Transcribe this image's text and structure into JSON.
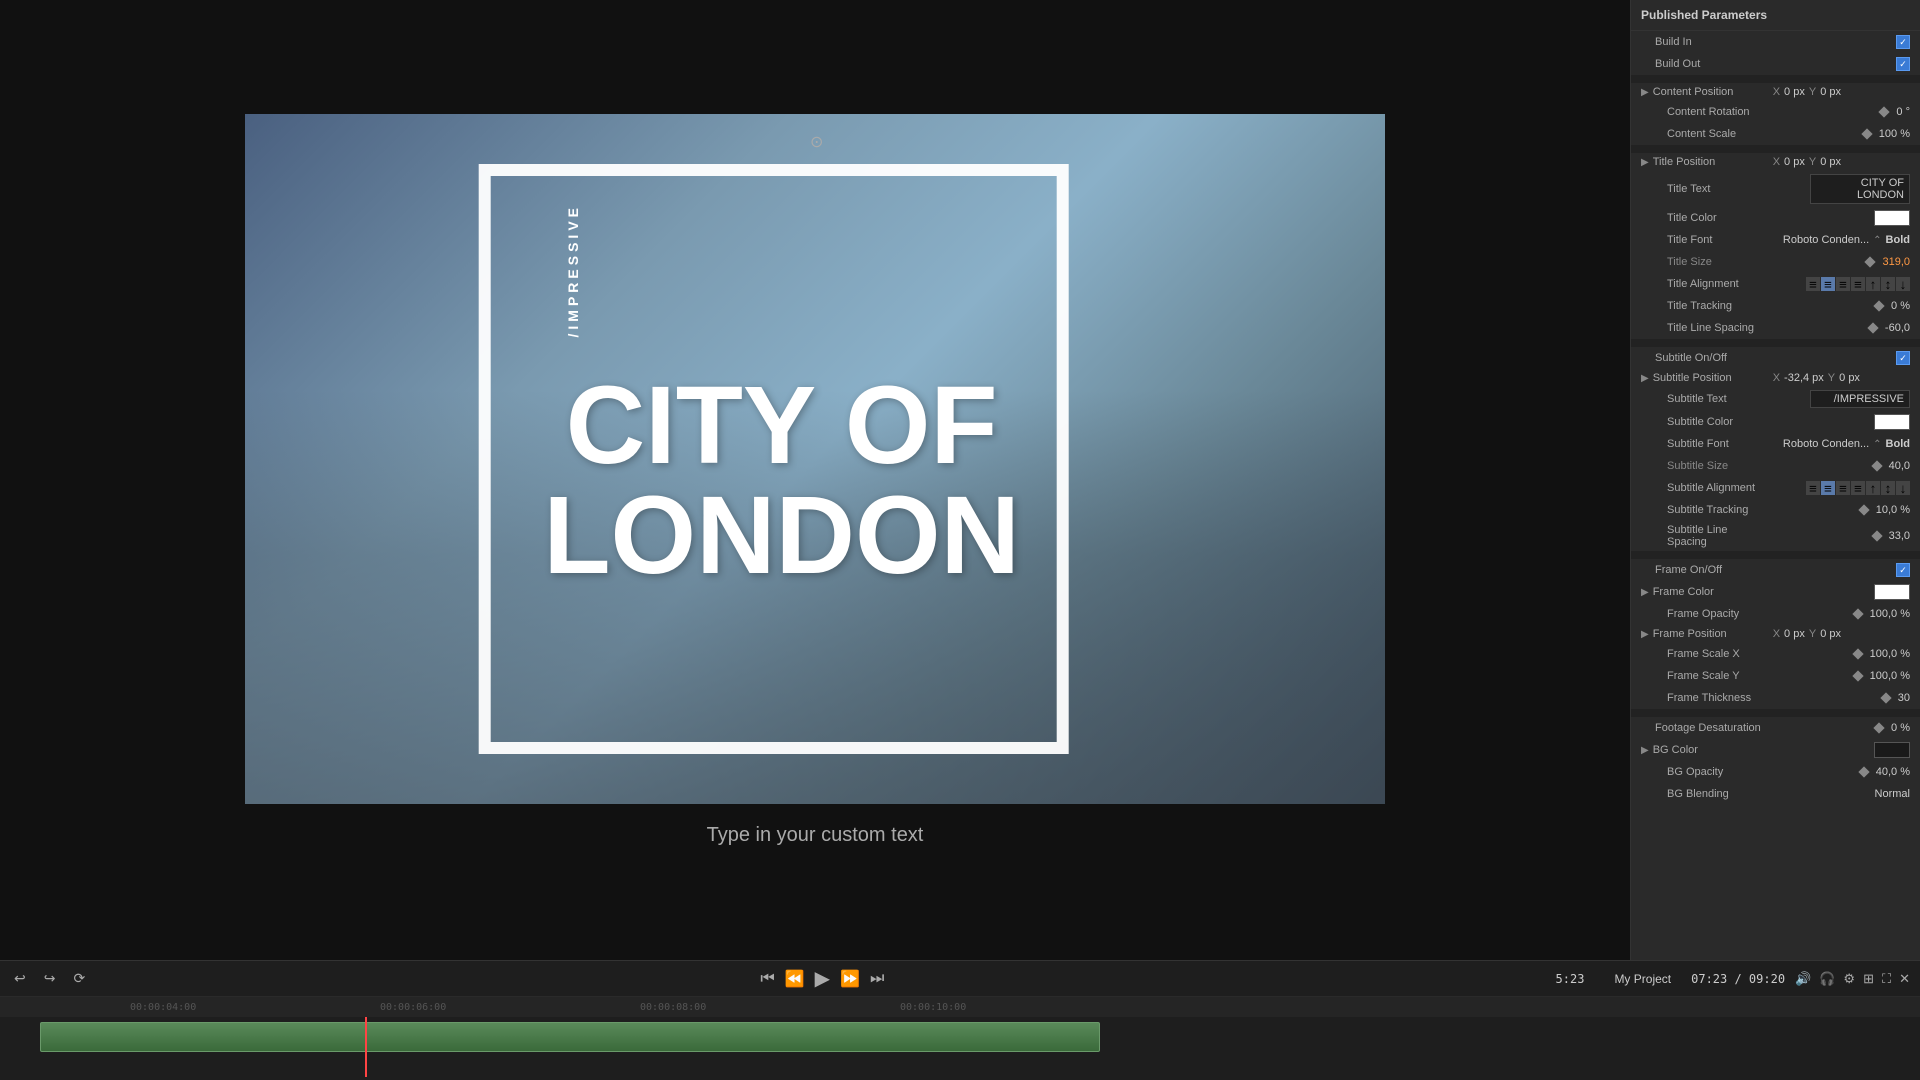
{
  "panel": {
    "title": "Published Parameters",
    "sections": {
      "buildIn": {
        "label": "Build In",
        "checked": true
      },
      "buildOut": {
        "label": "Build Out",
        "checked": true
      },
      "contentPosition": {
        "label": "Content Position",
        "x_label": "X",
        "x_value": "0 px",
        "y_label": "Y",
        "y_value": "0 px"
      },
      "contentRotation": {
        "label": "Content Rotation",
        "value": "0 °"
      },
      "contentScale": {
        "label": "Content Scale",
        "value": "100 %"
      },
      "titlePosition": {
        "label": "Title Position",
        "x_label": "X",
        "x_value": "0 px",
        "y_label": "Y",
        "y_value": "0 px"
      },
      "titleText": {
        "label": "Title Text",
        "value": "CITY OF\nLONDON"
      },
      "titleColor": {
        "label": "Title Color"
      },
      "titleFont": {
        "label": "Title Font",
        "font": "Roboto Conden...",
        "weight": "Bold"
      },
      "titleSize": {
        "label": "Title Size",
        "value": "319,0"
      },
      "titleAlignment": {
        "label": "Title Alignment"
      },
      "titleTracking": {
        "label": "Title Tracking",
        "value": "0 %"
      },
      "titleLineSpacing": {
        "label": "Title Line Spacing",
        "value": "-60,0"
      },
      "subtitleOnOff": {
        "label": "Subtitle On/Off",
        "checked": true
      },
      "subtitlePosition": {
        "label": "Subtitle Position",
        "x_label": "X",
        "x_value": "-32,4 px",
        "y_label": "Y",
        "y_value": "0 px"
      },
      "subtitleText": {
        "label": "Subtitle Text",
        "value": "/IMPRESSIVE"
      },
      "subtitleColor": {
        "label": "Subtitle Color"
      },
      "subtitleFont": {
        "label": "Subtitle Font",
        "font": "Roboto Conden...",
        "weight": "Bold"
      },
      "subtitleSize": {
        "label": "Subtitle Size",
        "value": "40,0"
      },
      "subtitleAlignment": {
        "label": "Subtitle Alignment"
      },
      "subtitleTracking": {
        "label": "Subtitle Tracking",
        "value": "10,0 %"
      },
      "subtitleLineSpacing": {
        "label": "Subtitle Line Spacing",
        "value": "33,0"
      },
      "frameOnOff": {
        "label": "Frame On/Off",
        "checked": true
      },
      "frameColor": {
        "label": "Frame Color"
      },
      "frameOpacity": {
        "label": "Frame Opacity",
        "value": "100,0 %"
      },
      "framePosition": {
        "label": "Frame Position",
        "x_label": "X",
        "x_value": "0 px",
        "y_label": "Y",
        "y_value": "0 px"
      },
      "frameScaleX": {
        "label": "Frame Scale X",
        "value": "100,0 %"
      },
      "frameScaleY": {
        "label": "Frame Scale Y",
        "value": "100,0 %"
      },
      "frameThickness": {
        "label": "Frame Thickness",
        "value": "30"
      },
      "footageDesaturation": {
        "label": "Footage Desaturation",
        "value": "0 %"
      },
      "bgColor": {
        "label": "BG Color"
      },
      "bgOpacity": {
        "label": "BG Opacity",
        "value": "40,0 %"
      },
      "bgBlending": {
        "label": "BG Blending",
        "value": "Normal"
      }
    }
  },
  "preview": {
    "title_line1": "CITY OF",
    "title_line2": "LONDON",
    "subtitle": "/IMPRESSIVE",
    "custom_text": "Type in your custom text"
  },
  "timeline": {
    "project_name": "My Project",
    "timecode": "07:23 / 09:20",
    "duration": "5:23",
    "rulers": [
      "00:00:04:00",
      "00:00:06:00",
      "00:00:08:00",
      "00:00:10:00"
    ]
  }
}
